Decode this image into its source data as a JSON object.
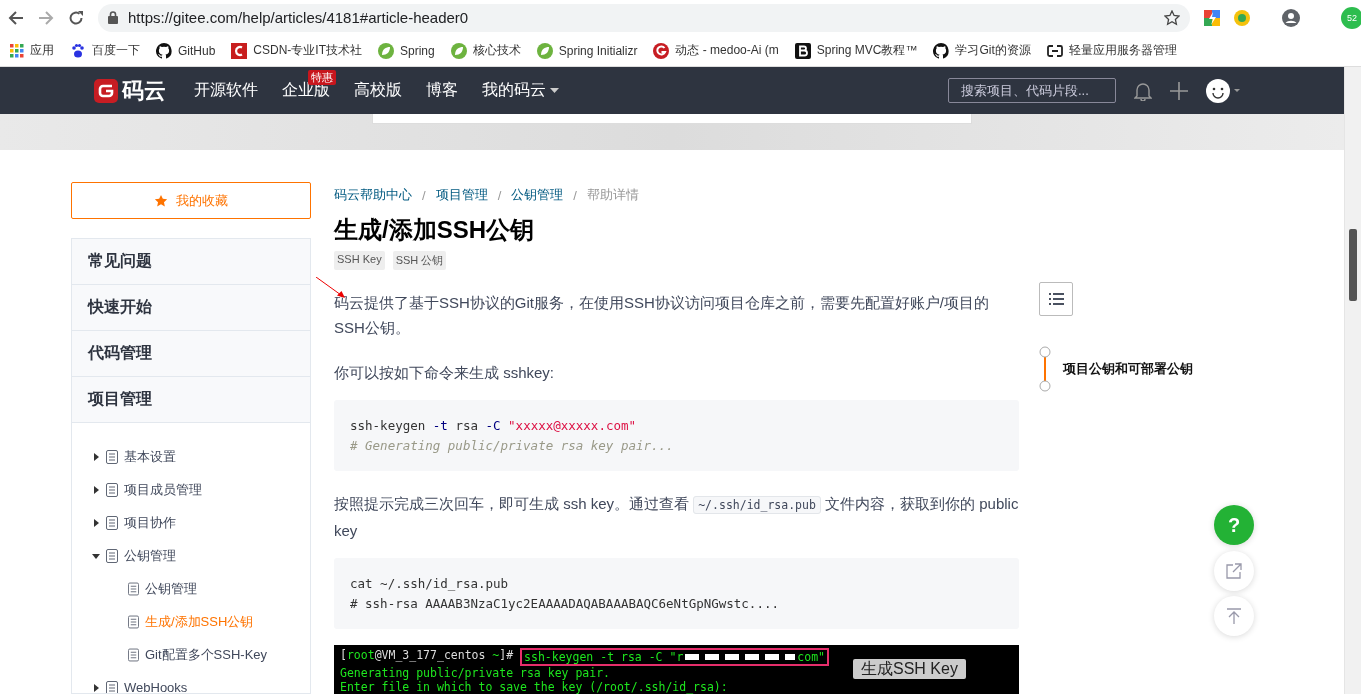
{
  "browser": {
    "url": "https://gitee.com/help/articles/4181#article-header0",
    "extension_badge": "52",
    "bookmarks": [
      {
        "label": "应用",
        "kind": "apps"
      },
      {
        "label": "百度一下",
        "kind": "paw"
      },
      {
        "label": "GitHub",
        "kind": "octocat"
      },
      {
        "label": "CSDN-专业IT技术社",
        "kind": "letter-c"
      },
      {
        "label": "Spring",
        "kind": "leaf"
      },
      {
        "label": "核心技术",
        "kind": "leaf"
      },
      {
        "label": "Spring Initializr",
        "kind": "leaf"
      },
      {
        "label": "动态 - medoo-Ai (m",
        "kind": "letter-g"
      },
      {
        "label": "Spring MVC教程™",
        "kind": "letter-b"
      },
      {
        "label": "学习Git的资源",
        "kind": "octocat"
      },
      {
        "label": "轻量应用服务器管理",
        "kind": "cloud"
      }
    ]
  },
  "navbar": {
    "logo": "码云",
    "links": [
      {
        "label": "开源软件",
        "dropdown": false
      },
      {
        "label": "企业版",
        "badge": "特惠",
        "dropdown": false
      },
      {
        "label": "高校版",
        "dropdown": false
      },
      {
        "label": "博客",
        "dropdown": false
      },
      {
        "label": "我的码云",
        "dropdown": true
      }
    ],
    "search": {
      "placeholder": "搜索项目、代码片段..."
    }
  },
  "sidebar": {
    "favorites": "我的收藏",
    "sections": [
      {
        "label": "常见问题"
      },
      {
        "label": "快速开始"
      },
      {
        "label": "代码管理"
      },
      {
        "label": "项目管理"
      }
    ],
    "tree": [
      {
        "label": "基本设置",
        "expanded": false,
        "selected": false
      },
      {
        "label": "项目成员管理",
        "expanded": false,
        "selected": false
      },
      {
        "label": "项目协作",
        "expanded": false,
        "selected": false
      },
      {
        "label": "公钥管理",
        "expanded": true,
        "selected": false,
        "children": [
          {
            "label": "公钥管理",
            "selected": false
          },
          {
            "label": "生成/添加SSH公钥",
            "selected": true
          },
          {
            "label": "Git配置多个SSH-Key",
            "selected": false
          }
        ]
      },
      {
        "label": "WebHooks",
        "expanded": false,
        "selected": false
      }
    ]
  },
  "article": {
    "breadcrumb": [
      {
        "label": "码云帮助中心",
        "current": false
      },
      {
        "separator": "/",
        "label": "项目管理",
        "current": false
      },
      {
        "separator": "/",
        "label": "公钥管理",
        "current": false
      },
      {
        "separator": "/",
        "label": "帮助详情",
        "current": true
      }
    ],
    "title": "生成/添加SSH公钥",
    "tags": [
      "SSH Key",
      "SSH 公钥"
    ],
    "blocks": [
      {
        "kind": "paragraph",
        "text": "码云提供了基于SSH协议的Git服务，在使用SSH协议访问项目仓库之前，需要先配置好账户/项目的SSH公钥。"
      },
      {
        "kind": "paragraph",
        "text": "你可以按如下命令来生成 sshkey:"
      },
      {
        "kind": "code",
        "lines": [
          [
            {
              "kind": "plain",
              "text": "ssh-keygen "
            },
            {
              "kind": "flag",
              "text": "-t"
            },
            {
              "kind": "plain",
              "text": " rsa "
            },
            {
              "kind": "flag",
              "text": "-C"
            },
            {
              "kind": "string",
              "text": " \"xxxxx@xxxxx.com\""
            }
          ],
          [
            {
              "kind": "comment",
              "text": "# Generating public/private rsa key pair..."
            }
          ]
        ]
      },
      {
        "kind": "paragraph",
        "text": "按照提示完成三次回车，即可生成 ssh key。通过查看 ",
        "code": "~/.ssh/id_rsa.pub",
        "after": " 文件内容，获取到你的 public key"
      },
      {
        "kind": "code",
        "lines": [
          [
            {
              "kind": "plain",
              "text": "cat ~/.ssh/id_rsa.pub"
            }
          ],
          [
            {
              "kind": "plain",
              "text": "# ssh-rsa AAAAB3NzaC1yc2EAAAADAQABAAABAQC6eNtGpNGwstc...."
            }
          ]
        ]
      },
      {
        "kind": "terminal",
        "caption": "生成SSH Key",
        "lines": [
          [
            {
              "kind": "white",
              "text": "["
            },
            {
              "kind": "green",
              "text": "root"
            },
            {
              "kind": "white",
              "text": "@VM_3_177_centos "
            },
            {
              "kind": "green",
              "text": "~"
            },
            {
              "kind": "white",
              "text": "]# "
            },
            {
              "kind": "command",
              "text": "ssh-keygen -t rsa -C \"r"
            },
            {
              "kind": "redacted"
            },
            {
              "kind": "command",
              "text": "com\""
            }
          ],
          [
            {
              "kind": "green",
              "text": "Generating public/private rsa key pair."
            }
          ],
          [
            {
              "kind": "green",
              "text": "Enter file in which to save the key (/root/.ssh/id_rsa):"
            }
          ]
        ]
      }
    ]
  },
  "toc": {
    "items": [
      {
        "label": "项目公钥和可部署公钥",
        "selected": true
      }
    ]
  },
  "floating": {
    "help": "?"
  }
}
